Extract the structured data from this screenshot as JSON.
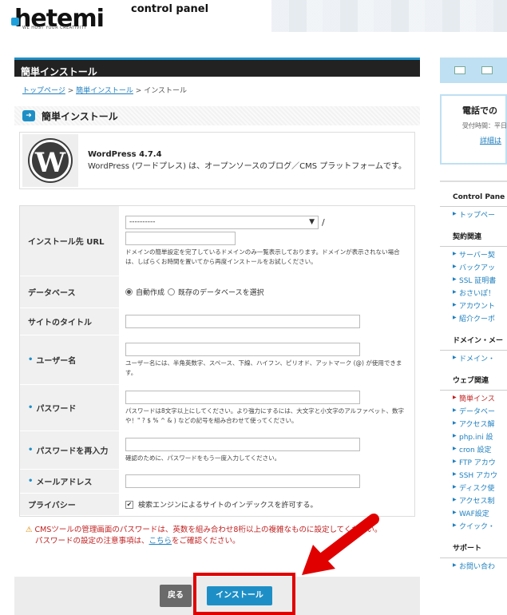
{
  "header": {
    "logo_text": "hetemi",
    "logo_tagline": "WE HOST YOUR CREATIVITY",
    "control_panel": "control panel"
  },
  "main": {
    "title": "簡単インストール",
    "breadcrumb": {
      "home": "トップページ",
      "sep1": " > ",
      "parent": "簡単インストール",
      "sep2": " > ",
      "current": "インストール"
    },
    "section_title": "簡単インストール",
    "app": {
      "name": "WordPress 4.7.4",
      "description": "WordPress (ワードプレス) は、オープンソースのブログ／CMS プラットフォームです。"
    },
    "form": {
      "url": {
        "label": "インストール先 URL",
        "select_value": "----------",
        "slash": "/",
        "help": "ドメインの簡単設定を完了しているドメインのみ一覧表示しております。ドメインが表示されない場合は、しばらくお時間を置いてから再度インストールをお試しください。"
      },
      "database": {
        "label": "データベース",
        "opt_auto": "自動作成",
        "opt_existing": "既存のデータベースを選択"
      },
      "site_title": {
        "label": "サイトのタイトル"
      },
      "username": {
        "label": "ユーザー名",
        "help": "ユーザー名には、半角英数字、スペース、下線、ハイフン、ピリオド、アットマーク (@) が使用できます。"
      },
      "password": {
        "label": "パスワード",
        "help": "パスワードは8文字以上にしてください。より強力にするには、大文字と小文字のアルファベット、数字や！\" ? $ % ^ & ) などの記号を組み合わせて使ってください。"
      },
      "password2": {
        "label": "パスワードを再入力",
        "help": "確認のために、パスワードをもう一度入力してください。"
      },
      "email": {
        "label": "メールアドレス"
      },
      "privacy": {
        "label": "プライバシー",
        "checkbox_label": "検索エンジンによるサイトのインデックスを許可する。"
      }
    },
    "warning": {
      "line1": "CMSツールの管理画面のパスワードは、英数を組み合わせ8桁以上の複雑なものに設定してください。",
      "line2_prefix": "パスワードの設定の注意事項は、",
      "line2_link": "こちら",
      "line2_suffix": "をご確認ください。"
    },
    "buttons": {
      "back": "戻る",
      "install": "インストール"
    }
  },
  "sidebar": {
    "phone_title": "電話での",
    "phone_hours": "受付時間：平日",
    "phone_link": "詳細は",
    "sections": [
      {
        "title": "Control Pane",
        "items": [
          "トップペー"
        ]
      },
      {
        "title": "契約関連",
        "items": [
          "サーバー契",
          "バックアッ",
          "SSL 証明書",
          "おさいぽ！",
          "アカウント",
          "紹介クーポ"
        ]
      },
      {
        "title": "ドメイン・メー",
        "items": [
          "ドメイン・"
        ]
      },
      {
        "title": "ウェブ関連",
        "items": [
          "簡単インス",
          "データベー",
          "アクセス解",
          "php.ini 設",
          "cron 設定",
          "FTP アカウ",
          "SSH アカウ",
          "ディスク使",
          "アクセス制",
          "WAF設定",
          "クイック・"
        ]
      },
      {
        "title": "サポート",
        "items": [
          "お問い合わ"
        ]
      }
    ]
  },
  "colors": {
    "accent": "#1e8fc6",
    "warning": "#c02020",
    "highlight": "#e00000"
  }
}
